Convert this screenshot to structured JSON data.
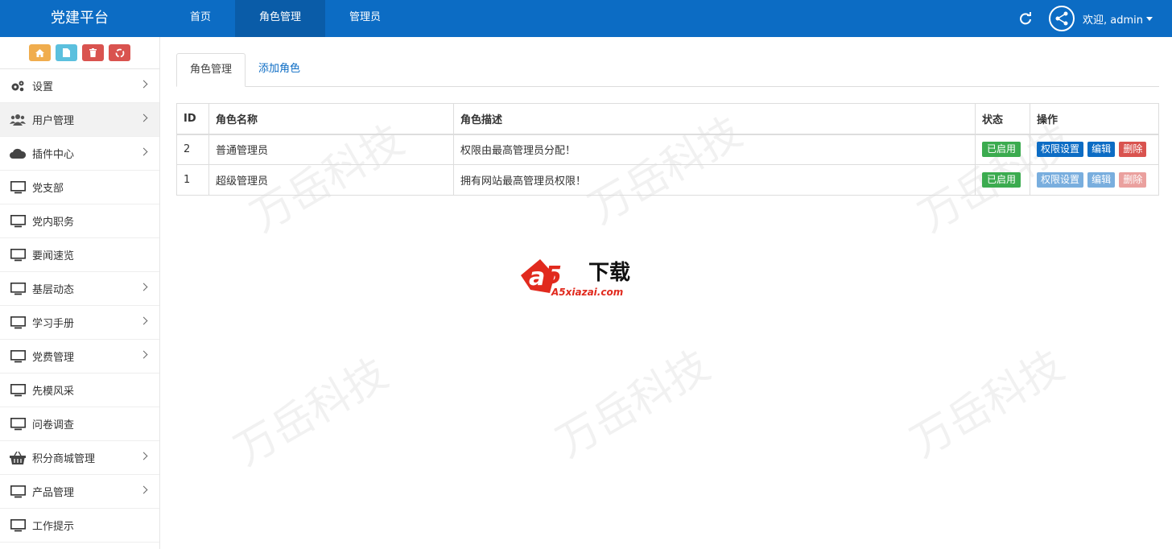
{
  "app": {
    "brand": "党建平台"
  },
  "nav": {
    "items": [
      "首页",
      "角色管理",
      "管理员"
    ],
    "active_index": 1
  },
  "user": {
    "welcome": "欢迎, admin"
  },
  "sidebar": {
    "shortcuts": [
      {
        "icon": "home-icon",
        "color": "#f0ad4e"
      },
      {
        "icon": "file-icon",
        "color": "#5bc0de"
      },
      {
        "icon": "trash-icon",
        "color": "#d9534f"
      },
      {
        "icon": "recycle-icon",
        "color": "#d9534f"
      }
    ],
    "items": [
      {
        "label": "设置",
        "icon": "gears-icon",
        "has_children": true
      },
      {
        "label": "用户管理",
        "icon": "users-icon",
        "has_children": true
      },
      {
        "label": "插件中心",
        "icon": "cloud-icon",
        "has_children": true
      },
      {
        "label": "党支部",
        "icon": "monitor-icon",
        "has_children": false
      },
      {
        "label": "党内职务",
        "icon": "monitor-icon",
        "has_children": false
      },
      {
        "label": "要闻速览",
        "icon": "monitor-icon",
        "has_children": false
      },
      {
        "label": "基层动态",
        "icon": "monitor-icon",
        "has_children": true
      },
      {
        "label": "学习手册",
        "icon": "monitor-icon",
        "has_children": true
      },
      {
        "label": "党费管理",
        "icon": "monitor-icon",
        "has_children": true
      },
      {
        "label": "先模风采",
        "icon": "monitor-icon",
        "has_children": false
      },
      {
        "label": "问卷调查",
        "icon": "monitor-icon",
        "has_children": false
      },
      {
        "label": "积分商城管理",
        "icon": "basket-icon",
        "has_children": true
      },
      {
        "label": "产品管理",
        "icon": "monitor-icon",
        "has_children": true
      },
      {
        "label": "工作提示",
        "icon": "monitor-icon",
        "has_children": false
      }
    ]
  },
  "tabs": {
    "items": [
      "角色管理",
      "添加角色"
    ],
    "active_index": 0
  },
  "table": {
    "headers": [
      "ID",
      "角色名称",
      "角色描述",
      "状态",
      "操作"
    ],
    "rows": [
      {
        "id": "2",
        "name": "普通管理员",
        "description": "权限由最高管理员分配！",
        "status": "已启用",
        "actions": [
          "权限设置",
          "编辑",
          "删除"
        ],
        "actions_disabled": false
      },
      {
        "id": "1",
        "name": "超级管理员",
        "description": "拥有网站最高管理员权限！",
        "status": "已启用",
        "actions": [
          "权限设置",
          "编辑",
          "删除"
        ],
        "actions_disabled": true
      }
    ]
  },
  "watermark": {
    "text": "万岳科技"
  },
  "logo": {
    "mark": "a5",
    "title": "下载",
    "domain": "A5xiazai.com"
  },
  "colors": {
    "primary": "#0c6cc4",
    "success": "#3bab4f",
    "danger": "#d9534f",
    "warning": "#f0ad4e",
    "info": "#5bc0de"
  }
}
